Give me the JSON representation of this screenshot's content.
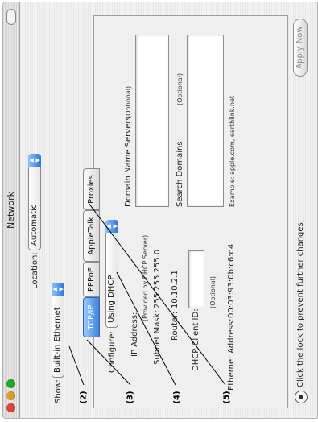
{
  "window": {
    "title": "Network",
    "colors": {
      "close": "#e0443e",
      "minimize": "#dea123",
      "zoom": "#1aab29",
      "accent": "#3b82e0"
    }
  },
  "location": {
    "label": "Location:",
    "value": "Automatic"
  },
  "show": {
    "label": "Show:",
    "value": "Built-in Ethernet"
  },
  "tabs": [
    {
      "label": "TCP/IP",
      "selected": true
    },
    {
      "label": "PPPoE",
      "selected": false
    },
    {
      "label": "AppleTalk",
      "selected": false
    },
    {
      "label": "Proxies",
      "selected": false
    }
  ],
  "configure": {
    "label": "Configure:",
    "value": "Using DHCP"
  },
  "dns": {
    "label": "Domain Name Servers",
    "optional": "(Optional)"
  },
  "search_domains": {
    "label": "Search Domains",
    "optional": "(Optional)"
  },
  "example_text": "Example: apple.com, earthlink.net",
  "ip_address": {
    "label": "IP Address:",
    "note": "(Provided by DHCP Server)"
  },
  "subnet_mask": {
    "label": "Subnet Mask:",
    "value": "255.255.255.0"
  },
  "router": {
    "label": "Router:",
    "value": "10.10.2.1"
  },
  "dhcp_client_id": {
    "label": "DHCP Client ID:",
    "note": "(Optional)"
  },
  "ethernet_address": {
    "label": "Ethernet Address:",
    "value": "00:03:93:0b:c6:d4"
  },
  "lock_text": "Click the lock to prevent further changes.",
  "apply_button": "Apply Now",
  "callouts": [
    "(2)",
    "(3)",
    "(4)",
    "(5)"
  ]
}
